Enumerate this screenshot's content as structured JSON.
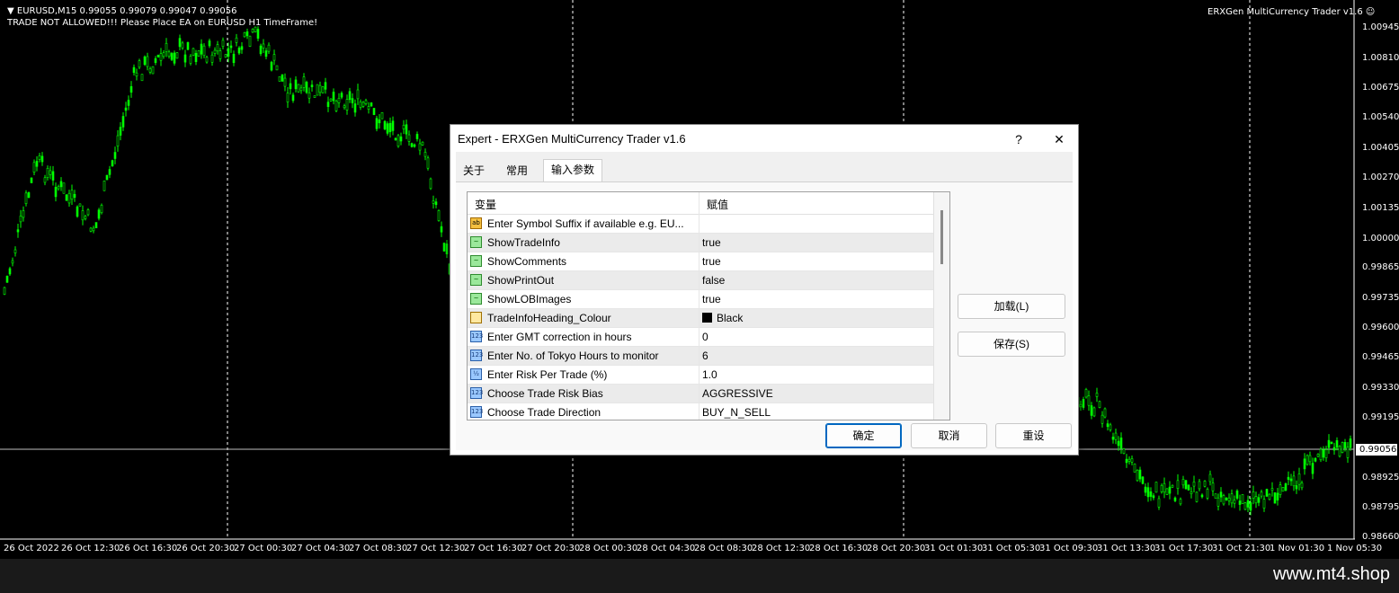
{
  "chart": {
    "symbol_info": "▼ EURUSD,M15  0.99055 0.99079 0.99047 0.99056",
    "warning": "TRADE NOT ALLOWED!!! Please Place EA on EURUSD H1 TimeFrame!",
    "ea_label": "ERXGen MultiCurrency Trader v1.6",
    "smiley": "☺",
    "current_price": "0.99056",
    "price_ticks": [
      "1.00945",
      "1.00810",
      "1.00675",
      "1.00540",
      "1.00405",
      "1.00270",
      "1.00135",
      "1.00000",
      "0.99865",
      "0.99735",
      "0.99600",
      "0.99465",
      "0.99330",
      "0.99195",
      "0.99056",
      "0.98925",
      "0.98795",
      "0.98660"
    ],
    "time_ticks": [
      "26 Oct 2022",
      "26 Oct 12:30",
      "26 Oct 16:30",
      "26 Oct 20:30",
      "27 Oct 00:30",
      "27 Oct 04:30",
      "27 Oct 08:30",
      "27 Oct 12:30",
      "27 Oct 16:30",
      "27 Oct 20:30",
      "28 Oct 00:30",
      "28 Oct 04:30",
      "28 Oct 08:30",
      "28 Oct 12:30",
      "28 Oct 16:30",
      "28 Oct 20:30",
      "31 Oct 01:30",
      "31 Oct 05:30",
      "31 Oct 09:30",
      "31 Oct 13:30",
      "31 Oct 17:30",
      "31 Oct 21:30",
      "1 Nov 01:30",
      "1 Nov 05:30"
    ],
    "colors": {
      "candles": "#00ff00",
      "background": "#000000",
      "grid": "#ffffff"
    }
  },
  "dialog": {
    "title": "Expert - ERXGen MultiCurrency Trader v1.6",
    "help": "?",
    "close": "✕",
    "tabs": [
      {
        "label": "关于"
      },
      {
        "label": "常用"
      },
      {
        "label": "输入参数"
      }
    ],
    "grid": {
      "col_variable": "变量",
      "col_value": "赋值",
      "rows": [
        {
          "icon": "ab",
          "type": "str",
          "name": "Enter Symbol Suffix if available e.g. EU...",
          "value": ""
        },
        {
          "icon": "~",
          "type": "bool",
          "name": "ShowTradeInfo",
          "value": "true"
        },
        {
          "icon": "~",
          "type": "bool",
          "name": "ShowComments",
          "value": "true"
        },
        {
          "icon": "~",
          "type": "bool",
          "name": "ShowPrintOut",
          "value": "false"
        },
        {
          "icon": "~",
          "type": "bool",
          "name": "ShowLOBImages",
          "value": "true"
        },
        {
          "icon": "",
          "type": "col",
          "name": "TradeInfoHeading_Colour",
          "value": "Black"
        },
        {
          "icon": "123",
          "type": "int",
          "name": "Enter GMT correction in hours",
          "value": "0"
        },
        {
          "icon": "123",
          "type": "int",
          "name": "Enter No. of Tokyo Hours to monitor",
          "value": "6"
        },
        {
          "icon": "½",
          "type": "dbl",
          "name": "Enter Risk Per Trade (%)",
          "value": "1.0"
        },
        {
          "icon": "123",
          "type": "int",
          "name": "Choose Trade Risk Bias",
          "value": "AGGRESSIVE"
        },
        {
          "icon": "123",
          "type": "int",
          "name": "Choose Trade Direction",
          "value": "BUY_N_SELL"
        }
      ]
    },
    "load_button": "加载(L)",
    "save_button": "保存(S)",
    "ok_button": "确定",
    "cancel_button": "取消",
    "reset_button": "重设"
  },
  "footer": {
    "watermark": "www.mt4.shop"
  }
}
